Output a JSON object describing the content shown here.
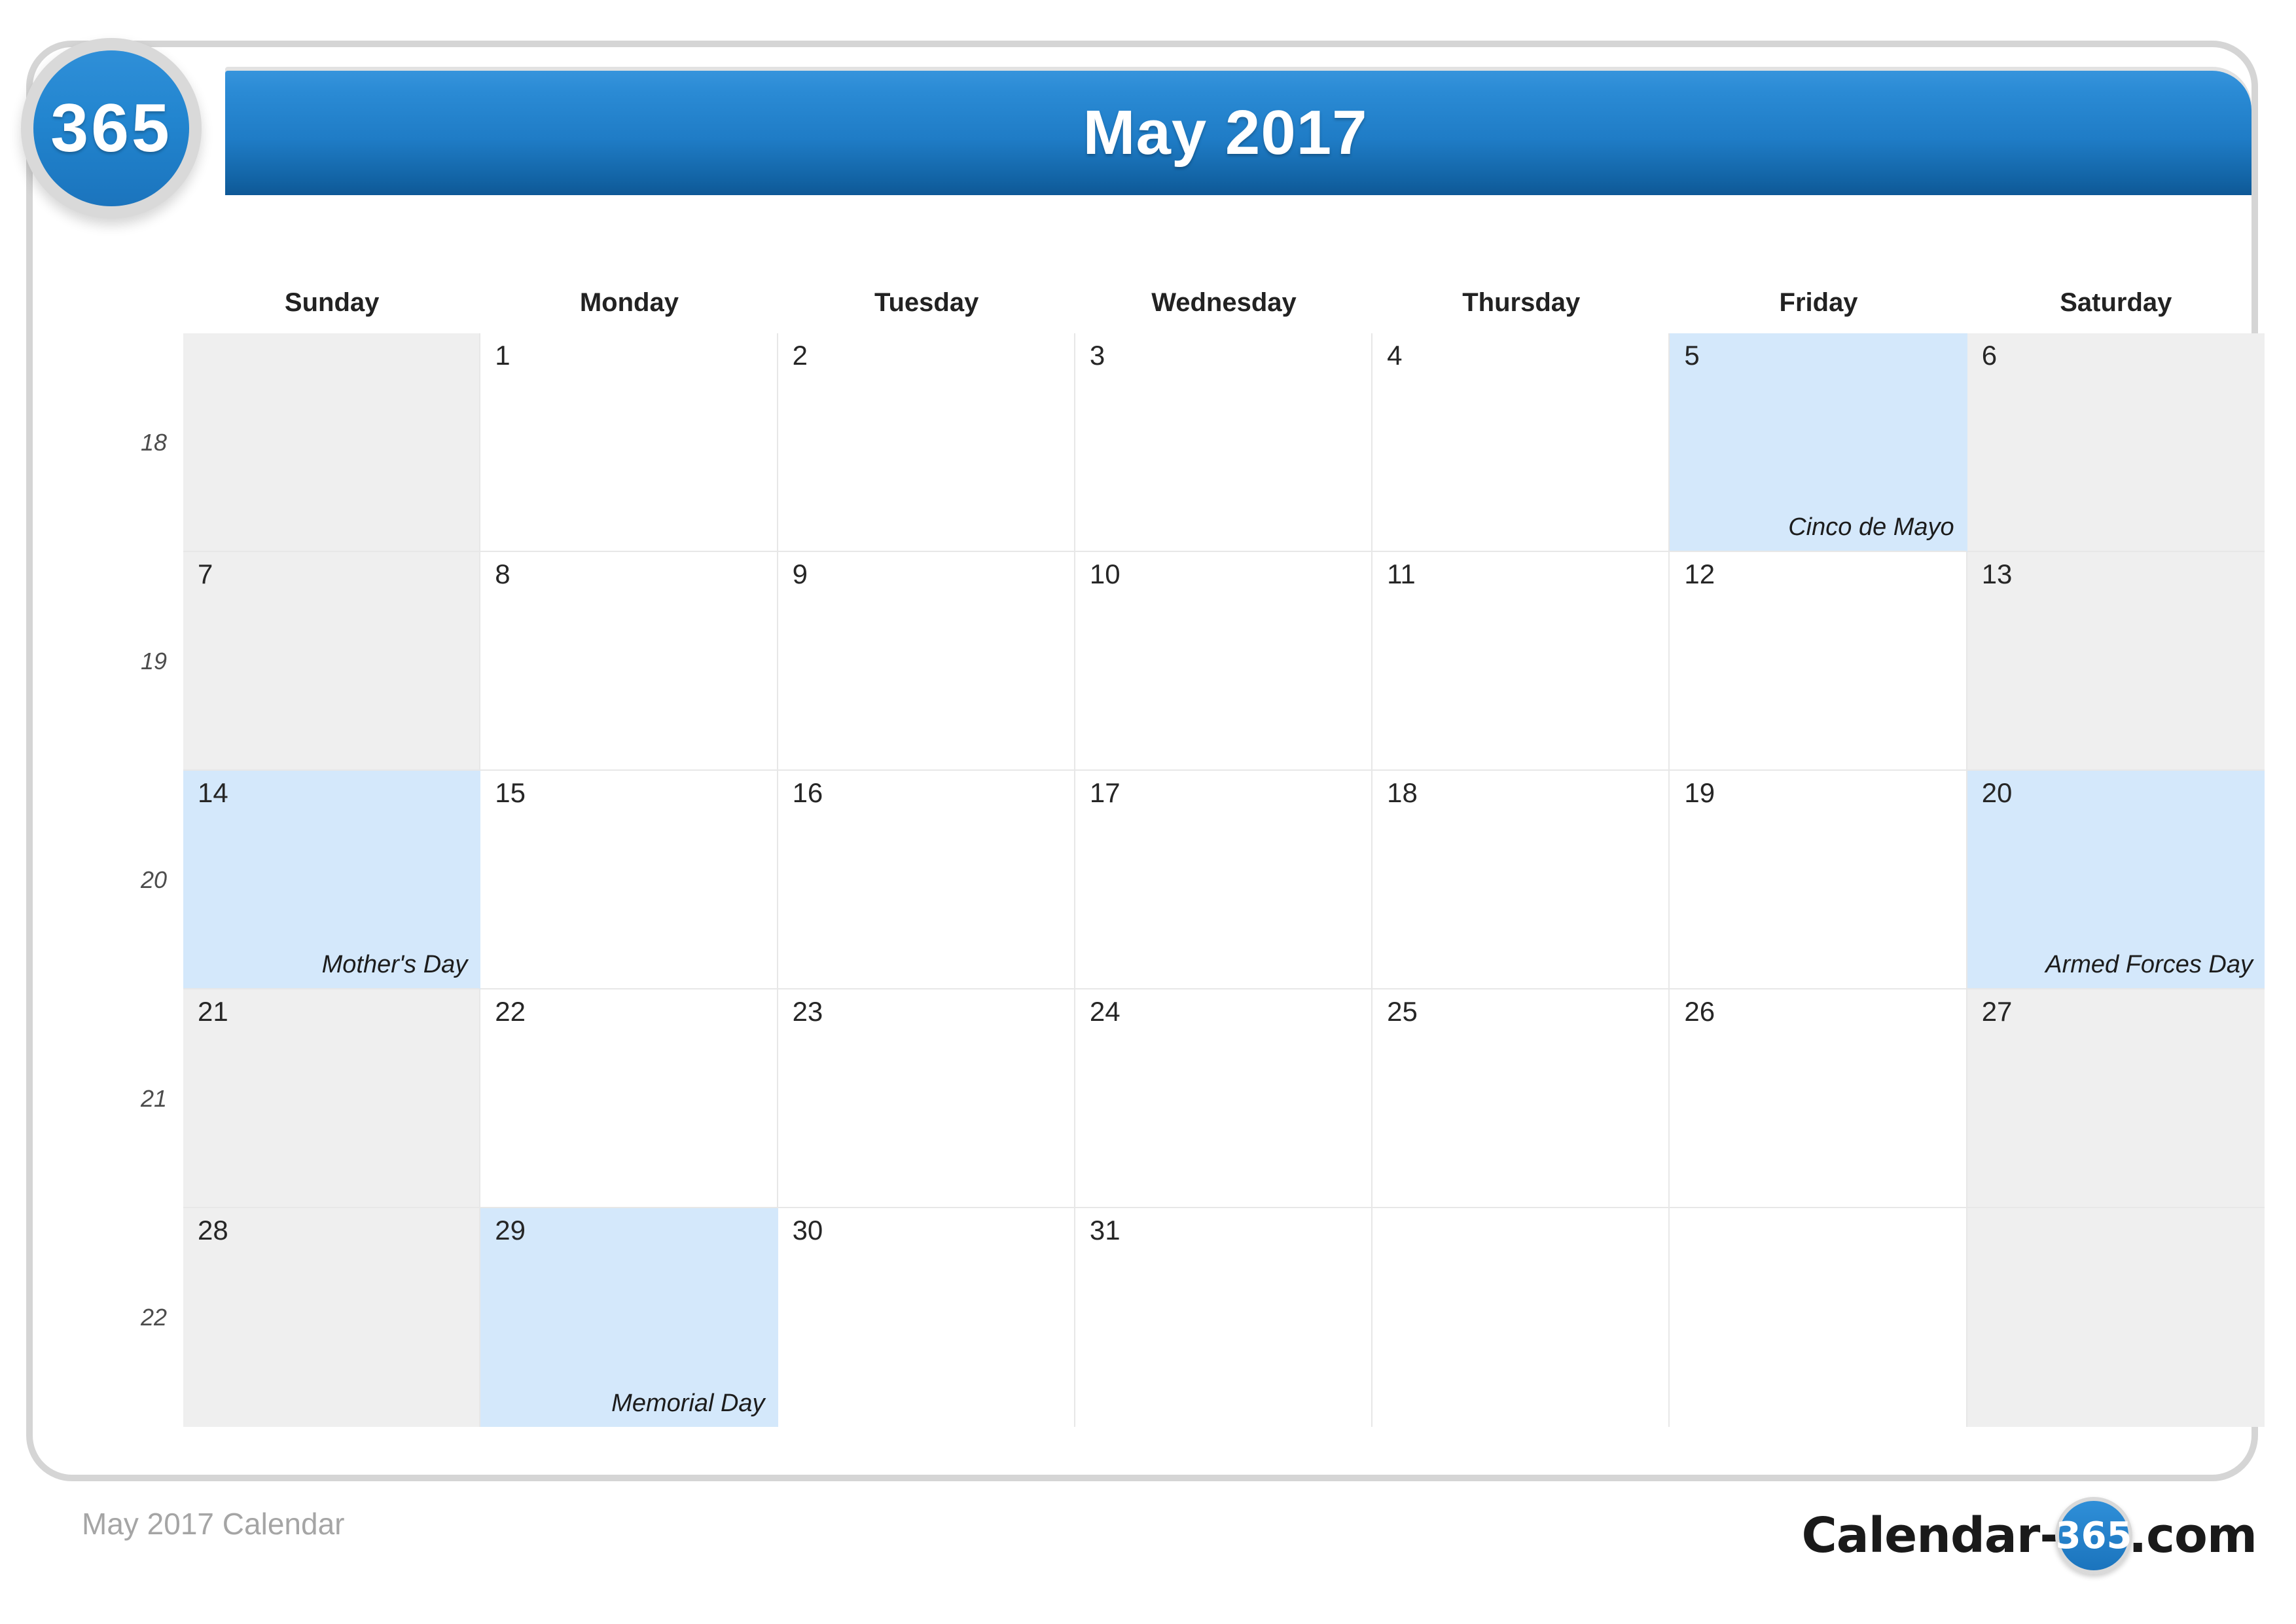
{
  "brand": {
    "badge_number": "365",
    "watermark_text": "365"
  },
  "header": {
    "title": "May 2017"
  },
  "calendar": {
    "weekdays": [
      "Sunday",
      "Monday",
      "Tuesday",
      "Wednesday",
      "Thursday",
      "Friday",
      "Saturday"
    ],
    "week_numbers": [
      "18",
      "19",
      "20",
      "21",
      "22"
    ],
    "weeks": [
      {
        "week_number": "18",
        "days": [
          {
            "day": "",
            "holiday": "",
            "state": "blank-gray"
          },
          {
            "day": "1",
            "holiday": "",
            "state": "weekday"
          },
          {
            "day": "2",
            "holiday": "",
            "state": "weekday"
          },
          {
            "day": "3",
            "holiday": "",
            "state": "weekday"
          },
          {
            "day": "4",
            "holiday": "",
            "state": "weekday"
          },
          {
            "day": "5",
            "holiday": "Cinco de Mayo",
            "state": "holiday"
          },
          {
            "day": "6",
            "holiday": "",
            "state": "weekend"
          }
        ]
      },
      {
        "week_number": "19",
        "days": [
          {
            "day": "7",
            "holiday": "",
            "state": "weekend"
          },
          {
            "day": "8",
            "holiday": "",
            "state": "weekday"
          },
          {
            "day": "9",
            "holiday": "",
            "state": "weekday"
          },
          {
            "day": "10",
            "holiday": "",
            "state": "weekday"
          },
          {
            "day": "11",
            "holiday": "",
            "state": "weekday"
          },
          {
            "day": "12",
            "holiday": "",
            "state": "weekday"
          },
          {
            "day": "13",
            "holiday": "",
            "state": "weekend"
          }
        ]
      },
      {
        "week_number": "20",
        "days": [
          {
            "day": "14",
            "holiday": "Mother's Day",
            "state": "holiday"
          },
          {
            "day": "15",
            "holiday": "",
            "state": "weekday"
          },
          {
            "day": "16",
            "holiday": "",
            "state": "weekday"
          },
          {
            "day": "17",
            "holiday": "",
            "state": "weekday"
          },
          {
            "day": "18",
            "holiday": "",
            "state": "weekday"
          },
          {
            "day": "19",
            "holiday": "",
            "state": "weekday"
          },
          {
            "day": "20",
            "holiday": "Armed Forces Day",
            "state": "holiday"
          }
        ]
      },
      {
        "week_number": "21",
        "days": [
          {
            "day": "21",
            "holiday": "",
            "state": "weekend"
          },
          {
            "day": "22",
            "holiday": "",
            "state": "weekday"
          },
          {
            "day": "23",
            "holiday": "",
            "state": "weekday"
          },
          {
            "day": "24",
            "holiday": "",
            "state": "weekday"
          },
          {
            "day": "25",
            "holiday": "",
            "state": "weekday"
          },
          {
            "day": "26",
            "holiday": "",
            "state": "weekday"
          },
          {
            "day": "27",
            "holiday": "",
            "state": "weekend"
          }
        ]
      },
      {
        "week_number": "22",
        "days": [
          {
            "day": "28",
            "holiday": "",
            "state": "weekend"
          },
          {
            "day": "29",
            "holiday": "Memorial Day",
            "state": "holiday"
          },
          {
            "day": "30",
            "holiday": "",
            "state": "weekday"
          },
          {
            "day": "31",
            "holiday": "",
            "state": "weekday"
          },
          {
            "day": "",
            "holiday": "",
            "state": "blank-white"
          },
          {
            "day": "",
            "holiday": "",
            "state": "blank-white"
          },
          {
            "day": "",
            "holiday": "",
            "state": "blank-gray"
          }
        ]
      }
    ]
  },
  "footer": {
    "caption": "May 2017 Calendar",
    "logo_prefix": "Calendar-",
    "logo_badge": "365",
    "logo_suffix": ".com"
  },
  "colors": {
    "header_blue": "#1f7cc6",
    "holiday_blue": "#d4e8fb",
    "weekend_gray": "#efefef",
    "frame_gray": "#d5d5d5",
    "grid_line": "#e7e7e7"
  }
}
